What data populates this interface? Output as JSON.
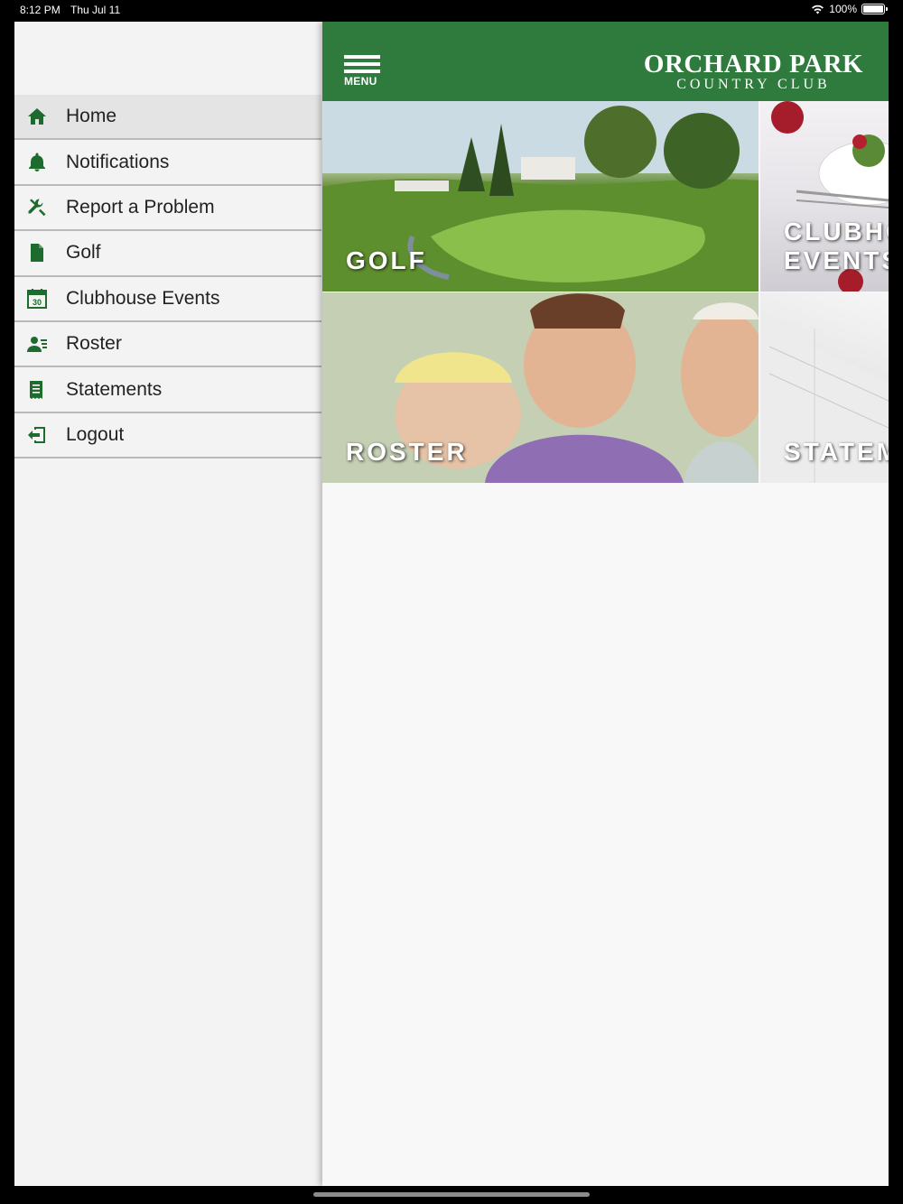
{
  "status_bar": {
    "time": "8:12 PM",
    "date": "Thu Jul 11",
    "battery": "100%"
  },
  "header": {
    "menu_label": "MENU",
    "logo_line1": "ORCHARD PARK",
    "logo_line2": "COUNTRY CLUB",
    "background_color": "#2f7b3e"
  },
  "sidebar": {
    "icon_color": "#1e6b2e",
    "items": [
      {
        "label": "Home",
        "icon": "home-icon",
        "active": true
      },
      {
        "label": "Notifications",
        "icon": "bell-icon",
        "active": false
      },
      {
        "label": "Report a Problem",
        "icon": "tools-icon",
        "active": false
      },
      {
        "label": "Golf",
        "icon": "document-icon",
        "active": false
      },
      {
        "label": "Clubhouse Events",
        "icon": "calendar-icon",
        "active": false
      },
      {
        "label": "Roster",
        "icon": "person-list-icon",
        "active": false
      },
      {
        "label": "Statements",
        "icon": "statement-icon",
        "active": false
      },
      {
        "label": "Logout",
        "icon": "logout-icon",
        "active": false
      }
    ]
  },
  "tiles": [
    {
      "label": "GOLF"
    },
    {
      "label": "CLUBHOUSE EVENTS"
    },
    {
      "label": "ROSTER"
    },
    {
      "label": "STATEMENTS"
    }
  ]
}
